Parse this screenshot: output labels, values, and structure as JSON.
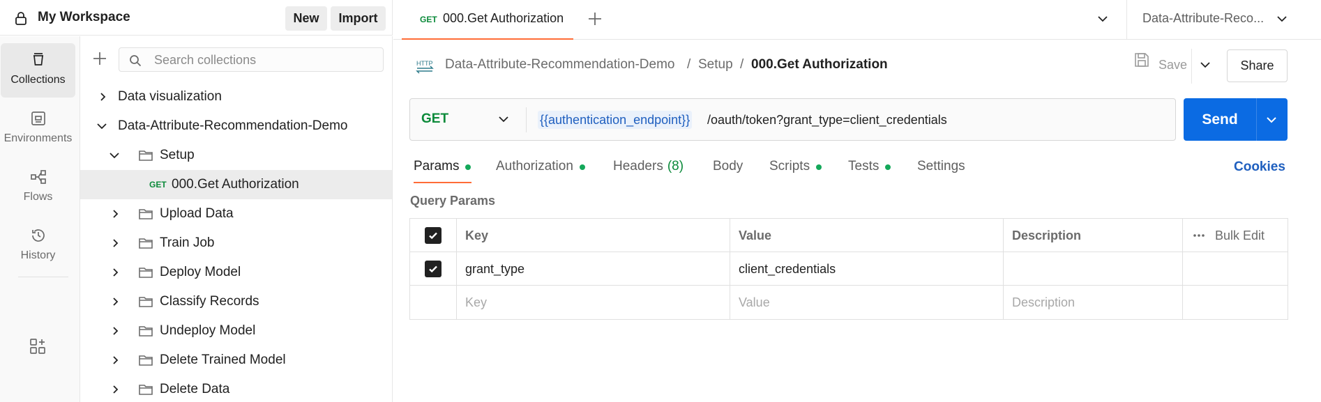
{
  "workspace": {
    "title": "My Workspace",
    "new_label": "New",
    "import_label": "Import"
  },
  "rail": {
    "items": [
      {
        "label": "Collections",
        "icon": "collections-icon",
        "active": true
      },
      {
        "label": "Environments",
        "icon": "environments-icon"
      },
      {
        "label": "Flows",
        "icon": "flows-icon"
      },
      {
        "label": "History",
        "icon": "history-icon"
      }
    ]
  },
  "sidebar": {
    "search_placeholder": "Search collections",
    "tree": [
      {
        "label": "Data visualization",
        "type": "collection",
        "expanded": false
      },
      {
        "label": "Data-Attribute-Recommendation-Demo",
        "type": "collection",
        "expanded": true
      },
      {
        "label": "Setup",
        "type": "folder",
        "expanded": true
      },
      {
        "label": "000.Get Authorization",
        "type": "request",
        "method": "GET",
        "selected": true
      },
      {
        "label": "Upload Data",
        "type": "folder"
      },
      {
        "label": "Train Job",
        "type": "folder"
      },
      {
        "label": "Deploy Model",
        "type": "folder"
      },
      {
        "label": "Classify Records",
        "type": "folder"
      },
      {
        "label": "Undeploy Model",
        "type": "folder"
      },
      {
        "label": "Delete Trained Model",
        "type": "folder"
      },
      {
        "label": "Delete Data",
        "type": "folder"
      }
    ]
  },
  "tabs": {
    "active": {
      "method": "GET",
      "title": "000.Get Authorization"
    },
    "environment": "Data-Attribute-Reco..."
  },
  "breadcrumb": {
    "collection": "Data-Attribute-Recommendation-Demo",
    "separator": "/",
    "folder": "Setup",
    "request": "000.Get Authorization"
  },
  "actions": {
    "save_label": "Save",
    "share_label": "Share"
  },
  "request": {
    "method": "GET",
    "url_variable": "{{authentication_endpoint}}",
    "url_path": "/oauth/token?grant_type=client_credentials",
    "send_label": "Send"
  },
  "request_tabs": {
    "items": [
      {
        "label": "Params",
        "dot": true,
        "active": true
      },
      {
        "label": "Authorization",
        "dot": true
      },
      {
        "label": "Headers",
        "count": "(8)"
      },
      {
        "label": "Body"
      },
      {
        "label": "Scripts",
        "dot": true
      },
      {
        "label": "Tests",
        "dot": true
      },
      {
        "label": "Settings"
      }
    ],
    "cookies_label": "Cookies"
  },
  "params": {
    "title": "Query Params",
    "headers": {
      "key": "Key",
      "value": "Value",
      "description": "Description",
      "bulk_edit": "Bulk Edit"
    },
    "rows": [
      {
        "checked": true,
        "key": "grant_type",
        "value": "client_credentials",
        "description": ""
      }
    ],
    "placeholder": {
      "key": "Key",
      "value": "Value",
      "description": "Description"
    }
  },
  "colors": {
    "accent_orange": "#ff6c37",
    "send_blue": "#0b6be3",
    "method_green": "#0b8a3a",
    "link_blue": "#1f5fbf"
  }
}
